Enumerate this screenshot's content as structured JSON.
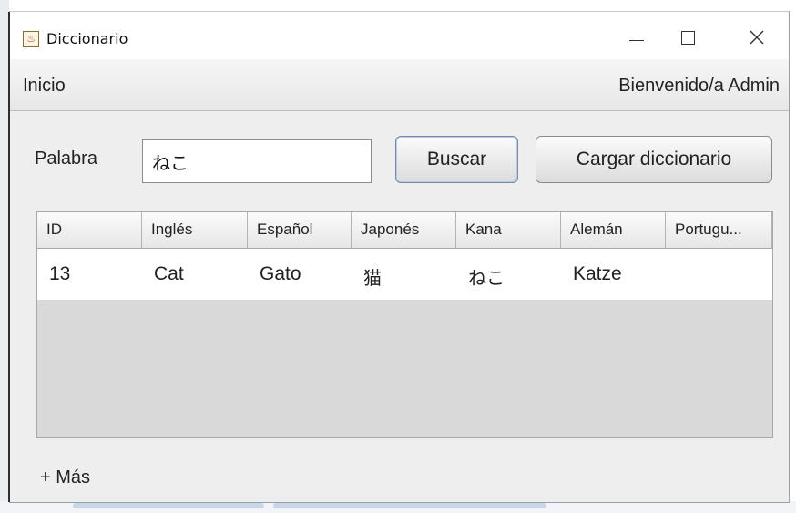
{
  "window": {
    "title": "Diccionario",
    "icon": "java-cup-icon"
  },
  "menubar": {
    "inicio": "Inicio",
    "welcome": "Bienvenido/a Admin"
  },
  "search": {
    "label": "Palabra",
    "value": "ねこ"
  },
  "buttons": {
    "buscar": "Buscar",
    "cargar": "Cargar diccionario"
  },
  "table": {
    "columns": [
      "ID",
      "Inglés",
      "Español",
      "Japonés",
      "Kana",
      "Alemán",
      "Portugu..."
    ],
    "rows": [
      [
        "13",
        "Cat",
        "Gato",
        "猫",
        "ねこ",
        "Katze",
        ""
      ]
    ]
  },
  "more": "+ Más"
}
